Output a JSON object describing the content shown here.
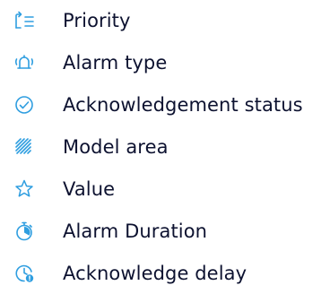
{
  "accent_color": "#2f9ee0",
  "text_color": "#0d1230",
  "menu": {
    "items": [
      {
        "label": "Priority",
        "icon": "priority-sort-icon"
      },
      {
        "label": "Alarm type",
        "icon": "alarm-bell-icon"
      },
      {
        "label": "Acknowledgement status",
        "icon": "check-circle-icon"
      },
      {
        "label": "Model area",
        "icon": "hatched-area-icon"
      },
      {
        "label": "Value",
        "icon": "star-icon"
      },
      {
        "label": "Alarm Duration",
        "icon": "stopwatch-icon"
      },
      {
        "label": "Acknowledge delay",
        "icon": "delay-clock-icon"
      }
    ]
  }
}
